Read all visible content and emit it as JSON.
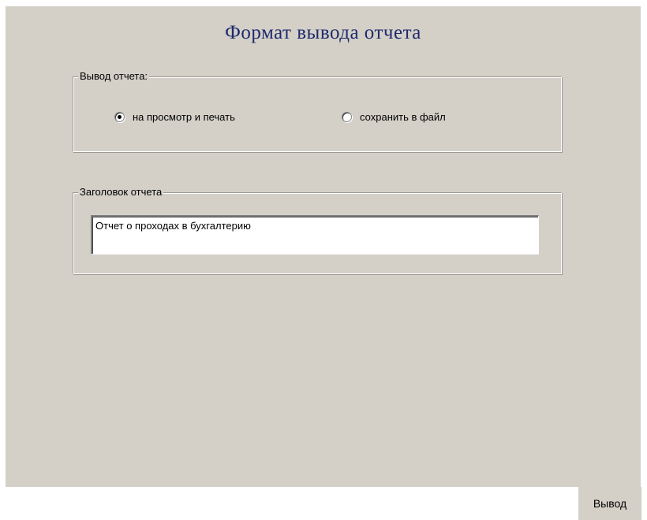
{
  "title": "Формат вывода отчета",
  "output_group": {
    "legend": "Вывод отчета:",
    "options": [
      {
        "label": "на просмотр и печать",
        "selected": true
      },
      {
        "label": "сохранить в файл",
        "selected": false
      }
    ]
  },
  "header_group": {
    "legend": "Заголовок отчета",
    "value": "Отчет о проходах в бухгалтерию"
  },
  "tabs": [
    {
      "label": "Вывод",
      "active": true
    }
  ]
}
